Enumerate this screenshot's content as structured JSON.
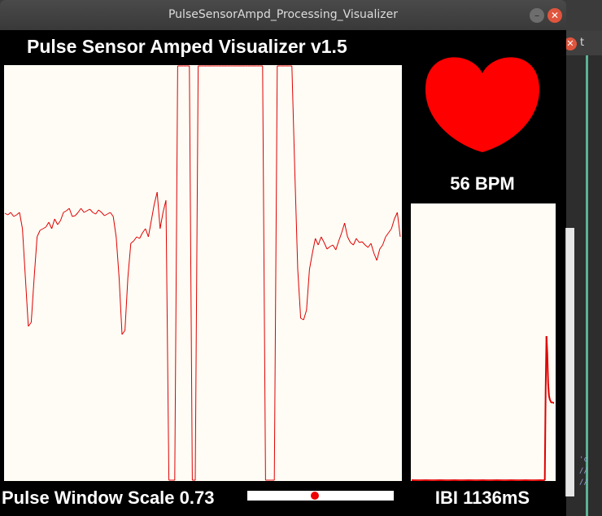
{
  "window": {
    "title": "PulseSensorAmpd_Processing_Visualizer",
    "min_glyph": "–",
    "close_glyph": "✕"
  },
  "background_app": {
    "close_glyph": "✕",
    "tab_label": "t",
    "code_lines": [
      "'c",
      "//",
      "//"
    ]
  },
  "visualizer": {
    "heading": "Pulse Sensor Amped Visualizer v1.5",
    "bpm_text": "56 BPM",
    "ibi_text": "IBI 1136mS",
    "scale_label": "Pulse Window Scale 0.73",
    "scale_slider_fraction": 0.46,
    "colors": {
      "trace": "#e00000",
      "heart": "#ff0000",
      "plot_bg": "#fefcf5",
      "canvas": "#000000"
    },
    "icons": {
      "heart": "heart-icon"
    }
  },
  "chart_data": [
    {
      "type": "line",
      "title": "",
      "series": [
        {
          "values": [
            329,
            327,
            330,
            325,
            327,
            330,
            310,
            250,
            190,
            195,
            250,
            300,
            308,
            310,
            312,
            318,
            310,
            322,
            315,
            320,
            330,
            332,
            335,
            325,
            326,
            330,
            335,
            330,
            332,
            334,
            330,
            328,
            333,
            330,
            326,
            328,
            330,
            325,
            300,
            250,
            180,
            185,
            250,
            292,
            295,
            300,
            298,
            305,
            310,
            300,
            320,
            340,
            355,
            310,
            330,
            345,
            -240,
            -240,
            -240,
            1000,
            1000,
            1000,
            1000,
            1000,
            -240,
            -240,
            1000,
            1000,
            1000,
            1000,
            1000,
            1000,
            1000,
            1000,
            1000,
            1000,
            1000,
            1000,
            1000,
            1000,
            1000,
            1000,
            1000,
            1000,
            1000,
            1000,
            1000,
            1000,
            1000,
            -240,
            -240,
            -240,
            -240,
            1000,
            1000,
            1000,
            1000,
            1000,
            1000,
            380,
            260,
            200,
            198,
            210,
            260,
            280,
            298,
            290,
            300,
            293,
            285,
            288,
            290,
            284,
            295,
            305,
            317,
            300,
            293,
            290,
            298,
            293,
            294,
            290,
            287,
            292,
            280,
            271,
            285,
            290,
            300,
            305,
            310,
            322,
            330,
            300
          ]
        }
      ]
    },
    {
      "type": "line",
      "title": "",
      "series": [
        {
          "values": [
            0,
            0,
            0,
            0,
            0,
            0,
            0,
            0,
            0,
            0,
            0,
            0,
            0,
            0,
            0,
            0,
            0,
            0,
            0,
            0,
            0,
            0,
            0,
            0,
            0,
            0,
            0,
            0,
            0,
            0,
            0,
            0,
            0,
            0,
            0,
            0,
            0,
            0,
            0,
            0,
            0,
            0,
            0,
            0,
            0,
            0,
            0,
            0,
            0,
            0,
            0,
            0,
            0,
            0,
            0,
            0,
            0,
            0,
            0,
            0,
            0,
            0,
            0,
            0,
            0,
            0,
            0,
            0,
            0,
            0,
            0,
            0,
            0,
            0,
            0,
            0,
            0,
            0,
            0,
            0,
            0,
            0,
            0,
            0,
            0,
            0,
            0,
            0,
            0,
            0,
            0,
            0,
            0,
            0,
            0,
            0,
            0,
            0,
            0,
            0,
            0,
            0,
            0,
            0,
            0,
            0,
            0,
            0,
            0,
            0,
            0,
            0,
            0,
            0,
            0,
            0,
            0,
            0,
            0,
            0,
            0,
            0,
            0,
            0,
            0,
            0,
            0,
            0,
            0,
            0,
            0,
            0,
            0,
            0,
            0,
            0,
            0,
            0,
            0,
            0,
            0,
            0,
            0,
            0,
            0,
            0,
            0,
            0,
            0,
            0,
            0,
            0,
            0,
            0,
            0,
            0,
            0,
            0,
            0,
            0,
            110,
            178,
            156,
            120,
            105,
            100,
            98,
            96,
            97,
            96,
            96
          ]
        }
      ]
    }
  ]
}
